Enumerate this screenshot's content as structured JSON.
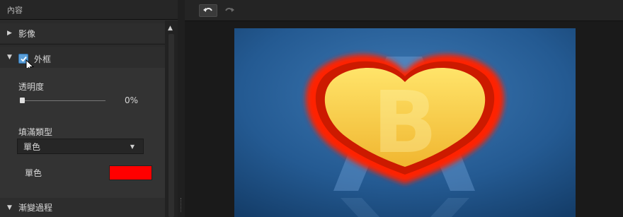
{
  "panel": {
    "header_title": "內容"
  },
  "sections": {
    "image": {
      "label": "影像",
      "expanded": false
    },
    "border": {
      "label": "外框",
      "expanded": true,
      "checked": true
    },
    "gradient": {
      "label": "漸變過程",
      "expanded": true
    }
  },
  "border_props": {
    "opacity_label": "透明度",
    "opacity_value": "0%",
    "fill_type_label": "填滿類型",
    "fill_type_value": "單色",
    "color_label": "單色",
    "color_value": "#ff0000"
  },
  "toolbar": {
    "undo_icon": "undo-icon",
    "redo_icon": "redo-icon"
  },
  "preview": {
    "logo_letter": "B"
  }
}
